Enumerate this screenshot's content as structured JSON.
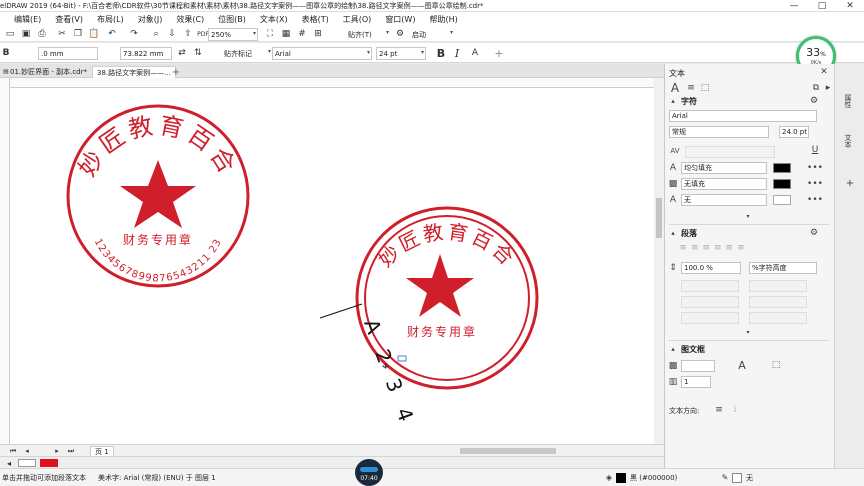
{
  "window": {
    "title": "elDRAW 2019 (64-Bit) - F:\\百合老师\\CDR软件\\30节课程和素材\\素材\\素材\\38.路径文字案例——图章公章的绘制\\38.路径文字案例——图章公章绘制.cdr*",
    "min": "—",
    "max": "□",
    "close": "✕"
  },
  "menu": [
    "编辑(E)",
    "查看(V)",
    "布局(L)",
    "对象(J)",
    "效果(C)",
    "位图(B)",
    "文本(X)",
    "表格(T)",
    "工具(O)",
    "窗口(W)",
    "帮助(H)"
  ],
  "toolbar": {
    "zoom": "250%",
    "snap": "贴齐(T)",
    "launch": "启动"
  },
  "propbar": {
    "offset_x": ".0 mm",
    "offset_y": "73.822 mm",
    "snap_marks": "贴齐标记",
    "font": "Arial",
    "size": "24 pt",
    "bold": "B",
    "italic": "I"
  },
  "progress": {
    "percent": "33",
    "percent_sign": "%",
    "speed": "0K/s"
  },
  "doc_tabs": [
    "01.妙匠界面 - 副本.cdr*",
    "38.路径文字案例——..."
  ],
  "stamp1": {
    "arc_text": "妙匠教育百合",
    "middle_text": "财务专用章",
    "number_text": "1234567899876543211 23",
    "color": "#d01e2a"
  },
  "stamp2": {
    "arc_text": "妙匠教育百合",
    "middle_text": "财务专用章",
    "path_text": "A 2 3 4"
  },
  "panel": {
    "title": "文本",
    "char_header": "字符",
    "font": "Arial",
    "style": "常规",
    "size": "24.0 pt",
    "fill1": "均匀填充",
    "fill2": "无填充",
    "outline": "无",
    "para_header": "段落",
    "line_spacing": "100.0 %",
    "line_unit": "%字符高度",
    "frame_header": "图文框",
    "columns": "1",
    "direction_label": "文本方向:"
  },
  "sidetabs": [
    "属性",
    "文本"
  ],
  "page": {
    "label": "页 1"
  },
  "status": {
    "hint": "单击并拖动可添加段落文本",
    "object": "美术字: Arial (常规) (ENU) 于 图层 1",
    "fill_label": "黑 (#000000)",
    "outline_label": "无",
    "time": "07:40"
  },
  "colors": {
    "accent": "#d01e2a",
    "progress": "#3cc06a"
  }
}
